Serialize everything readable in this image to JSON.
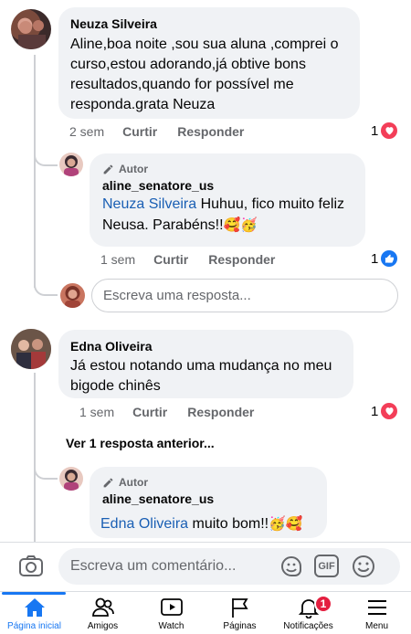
{
  "comments": [
    {
      "author": "Neuza Silveira",
      "lines": [
        "Aline,boa noite ,sou sua aluna ,comprei o",
        "curso,estou adorando,já obtive bons",
        "resultados,quando for possível me",
        "responda.grata Neuza"
      ],
      "time": "2 sem",
      "like_label": "Curtir",
      "reply_label": "Responder",
      "reaction_count": "1",
      "reaction_icon": "love-reaction-icon",
      "reply": {
        "badge": "Autor",
        "author": "aline_senatore_us",
        "mention": "Neuza Silveira",
        "text_after_mention": " Huhuu, fico muito feliz",
        "line2": "Neusa. Parabéns!!",
        "emojis": "🥰🥳",
        "time": "1 sem",
        "like_label": "Curtir",
        "reply_label": "Responder",
        "reaction_count": "1",
        "reaction_icon": "like-reaction-icon"
      },
      "reply_placeholder": "Escreva uma resposta..."
    },
    {
      "author": "Edna Oliveira",
      "lines": [
        "Já estou notando uma mudança no meu",
        "bigode chinês"
      ],
      "time": "1 sem",
      "like_label": "Curtir",
      "reply_label": "Responder",
      "reaction_count": "1",
      "reaction_icon": "love-reaction-icon",
      "view_previous": "Ver 1 resposta anterior...",
      "reply": {
        "badge": "Autor",
        "author": "aline_senatore_us",
        "mention": "Edna Oliveira",
        "text_after_mention": " muito bom!!",
        "emojis": "🥳🥰"
      }
    }
  ],
  "composer": {
    "placeholder": "Escreva um comentário...",
    "gif_label": "GIF"
  },
  "tabbar": {
    "tabs": [
      {
        "label": "Página inicial",
        "icon": "home-icon",
        "active": true
      },
      {
        "label": "Amigos",
        "icon": "friends-icon"
      },
      {
        "label": "Watch",
        "icon": "watch-icon"
      },
      {
        "label": "Páginas",
        "icon": "pages-flag-icon"
      },
      {
        "label": "Notificações",
        "icon": "bell-icon",
        "badge": "1"
      },
      {
        "label": "Menu",
        "icon": "menu-icon"
      }
    ]
  },
  "colors": {
    "accent": "#1877f2",
    "bubble": "#f0f2f5",
    "mention": "#1a5fb4",
    "love": "#f33e58",
    "badge": "#e41e3f"
  }
}
